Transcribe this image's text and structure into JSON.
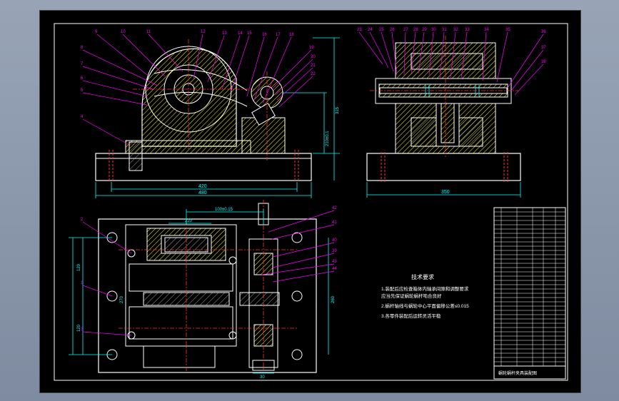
{
  "drawing": {
    "top_left_view": {
      "part_labels": [
        "9",
        "10",
        "11",
        "12",
        "13",
        "14",
        "15",
        "16",
        "17",
        "18",
        "19",
        "20",
        "21",
        "22",
        "8",
        "7",
        "6",
        "5",
        "4"
      ],
      "dimensions": {
        "width_inner": "420",
        "width_outer": "480",
        "height_right": "315",
        "height_inner": "210±0.1"
      }
    },
    "top_right_view": {
      "part_labels": [
        "23",
        "24",
        "25",
        "26",
        "27",
        "28",
        "29",
        "30",
        "31",
        "32",
        "33",
        "34",
        "35",
        "36",
        "37",
        "38"
      ],
      "dimensions": {
        "width": "350"
      }
    },
    "bottom_view": {
      "part_labels": [
        "2",
        "1",
        "3",
        "42",
        "41",
        "40",
        "39",
        "43",
        "44"
      ],
      "dimensions": {
        "top_offset": "100±0.15",
        "top_small": "220",
        "left_a": "120",
        "left_b": "270",
        "left_c": "120",
        "right_height": "260",
        "bottom_width": "30"
      }
    },
    "notes": {
      "title": "技术要求",
      "items": [
        "1.装配后应检查箱体内轴承间隙和调整要求",
        "  应当先保证蜗轮蜗杆啮合良好",
        "2.蜗杆轴线与蜗轮中心平面偏移公差≤0.015",
        "3.各零件装配后运转灵活平稳"
      ]
    },
    "title_block": {
      "title": "蜗轮蜗杆夹具装配图"
    }
  },
  "colors": {
    "background": "#000000",
    "outline": "#ffffff",
    "dimension": "#00ffff",
    "leader": "#ff00ff",
    "center_line": "#ff3333",
    "hatch": "#ffff00",
    "accent": "#33ff33"
  }
}
